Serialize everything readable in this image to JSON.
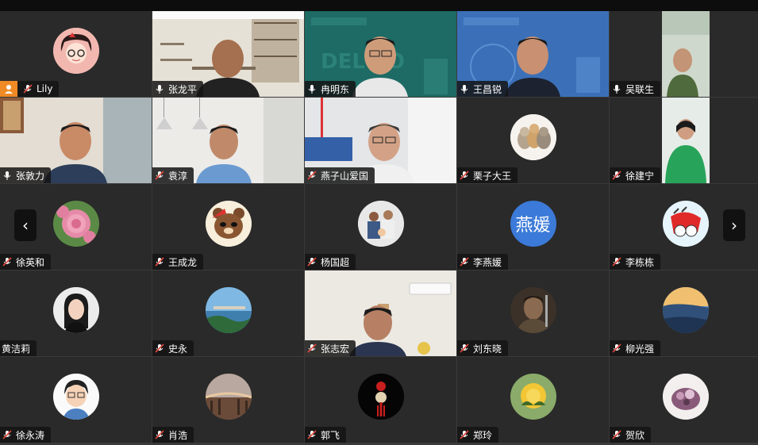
{
  "participants": [
    {
      "name": "Lily",
      "muted": true
    },
    {
      "name": "张龙平",
      "muted": false
    },
    {
      "name": "冉明东",
      "muted": false
    },
    {
      "name": "王昌锐",
      "muted": false
    },
    {
      "name": "吴联生",
      "muted": false
    },
    {
      "name": "张敦力",
      "muted": false
    },
    {
      "name": "袁淳",
      "muted": true
    },
    {
      "name": "燕子山爱国",
      "muted": true
    },
    {
      "name": "栗子大王",
      "muted": true
    },
    {
      "name": "徐建宁",
      "muted": true
    },
    {
      "name": "徐英和",
      "muted": true
    },
    {
      "name": "王成龙",
      "muted": true
    },
    {
      "name": "杨国超",
      "muted": true
    },
    {
      "name": "李燕媛",
      "muted": true,
      "avatar_text": "燕媛"
    },
    {
      "name": "李栋栋",
      "muted": true
    },
    {
      "name": "黄洁莉",
      "muted": true
    },
    {
      "name": "史永",
      "muted": true
    },
    {
      "name": "张志宏",
      "muted": true
    },
    {
      "name": "刘东晓",
      "muted": true
    },
    {
      "name": "柳光强",
      "muted": true
    },
    {
      "name": "徐永涛",
      "muted": true
    },
    {
      "name": "肖浩",
      "muted": true
    },
    {
      "name": "郭飞",
      "muted": true
    },
    {
      "name": "郑玲",
      "muted": true
    },
    {
      "name": "贺欣",
      "muted": true
    }
  ],
  "nav": {
    "prev": "‹",
    "next": "›"
  },
  "colors": {
    "muted_red": "#e0463c",
    "host_orange": "#f08a24",
    "avatar_blue": "#3b7ad8",
    "bg_teal": "#1f6f68",
    "bg_blue": "#3a6fb5"
  }
}
